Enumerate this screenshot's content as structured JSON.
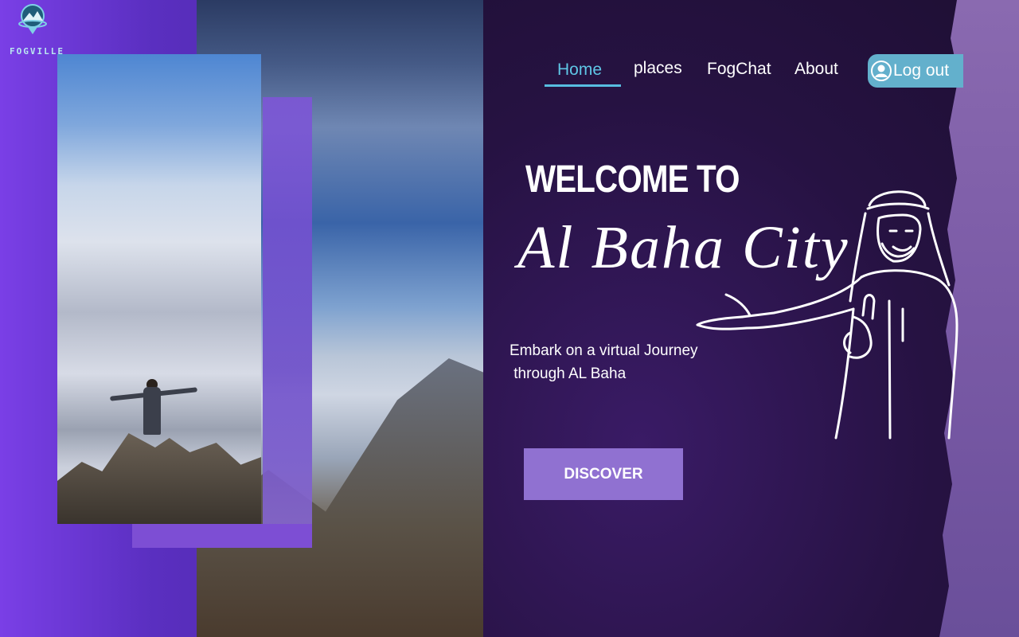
{
  "brand": {
    "logo_text": "FOGVILLE"
  },
  "nav": {
    "items": [
      {
        "label": "Home",
        "active": true
      },
      {
        "label": "places",
        "active": false
      },
      {
        "label": "FogChat",
        "active": false
      },
      {
        "label": "About",
        "active": false
      }
    ],
    "logout_label": "Log out"
  },
  "hero": {
    "welcome": "WELCOME TO",
    "city": "Al Baha City",
    "tagline": "Embark on a virtual Journey\n through AL Baha",
    "cta_label": "DISCOVER"
  },
  "icons": {
    "logo": "fogville-logo-icon",
    "user": "user-icon",
    "figure": "welcoming-man-illustration"
  },
  "colors": {
    "accent": "#5fc6e6",
    "button": "#9071d1",
    "logout_bg": "#63b0cc",
    "purple": "#7d4ed4"
  }
}
